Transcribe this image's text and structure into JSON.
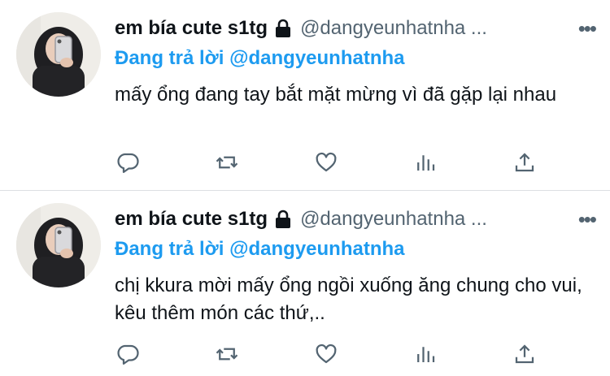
{
  "tweets": [
    {
      "name": "em bía cute s1tg",
      "handle": "@dangyeunhatnha ...",
      "more_label": "•••",
      "replying_label": "Đang trả lời",
      "replying_to": "@dangyeunhatnha",
      "text": "mấy ổng đang tay bắt mặt mừng vì đã gặp lại nhau"
    },
    {
      "name": "em bía cute s1tg",
      "handle": "@dangyeunhatnha ...",
      "more_label": "•••",
      "replying_label": "Đang trả lời",
      "replying_to": "@dangyeunhatnha",
      "text": "chị kkura mời mấy ổng ngồi xuống ăng chung cho vui, kêu thêm món các thứ,.."
    }
  ],
  "icons": {
    "lock": "lock-icon",
    "reply": "reply-icon",
    "retweet": "retweet-icon",
    "like": "heart-icon",
    "analytics": "analytics-icon",
    "share": "share-icon"
  },
  "colors": {
    "link": "#1d9bf0",
    "secondary": "#536471",
    "text": "#0f1419",
    "divider": "#dcdfe3"
  }
}
